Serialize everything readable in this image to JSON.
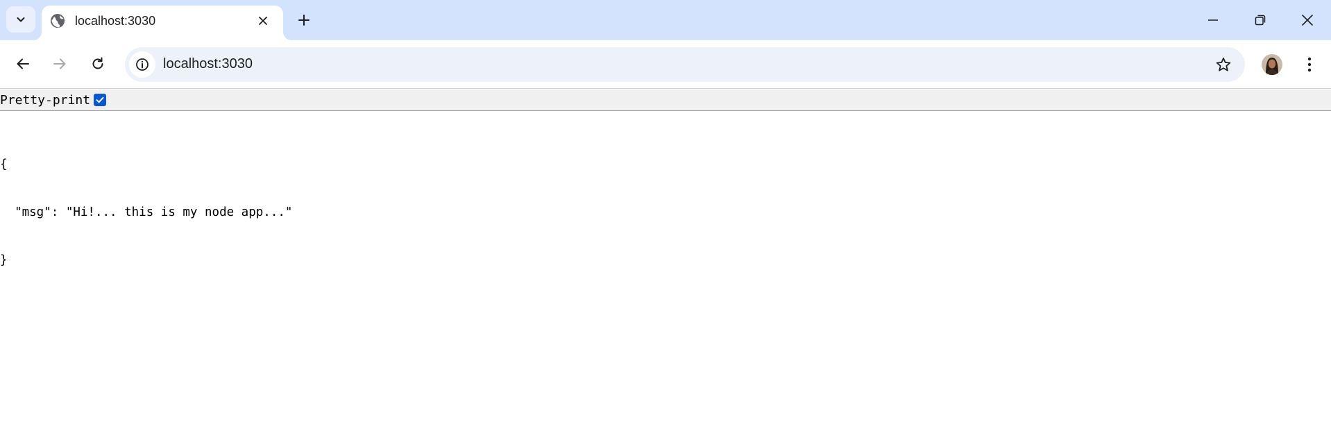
{
  "browser": {
    "tab": {
      "title": "localhost:3030",
      "favicon": "globe-icon"
    },
    "address_bar": {
      "url": "localhost:3030"
    },
    "icons": {
      "tab_search": "chevron-down-icon",
      "tab_close": "close-icon",
      "new_tab": "plus-icon",
      "minimize": "minimize-icon",
      "restore": "restore-icon",
      "window_close": "close-icon",
      "back": "arrow-left-icon",
      "forward": "arrow-right-icon",
      "reload": "reload-icon",
      "site_info": "info-icon",
      "bookmark": "star-icon",
      "menu": "more-vertical-icon"
    },
    "colors": {
      "tabstrip": "#d3e3fd",
      "omnibox": "#edf2fa",
      "checkbox": "#0b57d0"
    }
  },
  "page": {
    "pretty_print": {
      "label": "Pretty-print",
      "checked": true
    },
    "json_lines": [
      "{",
      "  \"msg\": \"Hi!... this is my node app...\"",
      "}"
    ]
  }
}
